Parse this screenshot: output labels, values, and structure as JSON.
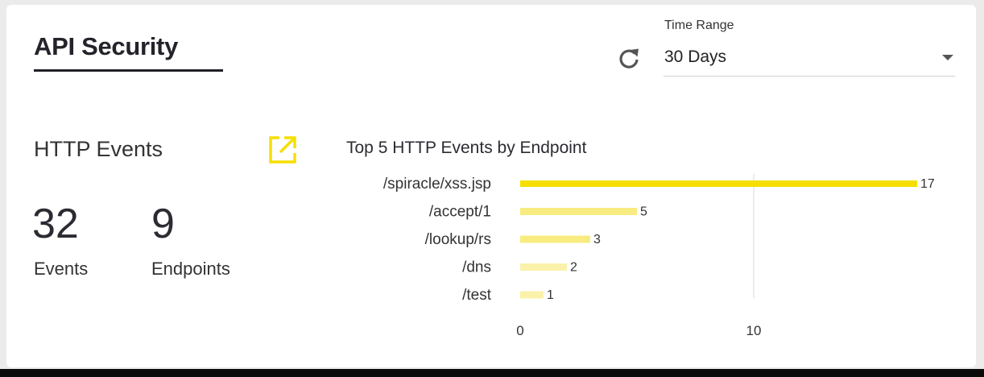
{
  "header": {
    "title": "API Security",
    "time_range_label": "Time Range",
    "time_range_value": "30 Days"
  },
  "http_events": {
    "title": "HTTP Events",
    "stats": [
      {
        "value": "32",
        "label": "Events"
      },
      {
        "value": "9",
        "label": "Endpoints"
      }
    ]
  },
  "colors": {
    "accent": "#f5df00",
    "bar_light": "#f8ec80",
    "bar_lighter": "#faf2aa",
    "text": "#2b2b33"
  },
  "icons": [
    "refresh-icon",
    "chevron-down-icon",
    "external-link-icon"
  ],
  "chart_data": {
    "type": "bar",
    "orientation": "horizontal",
    "title": "Top 5 HTTP Events by Endpoint",
    "categories": [
      "/spiracle/xss.jsp",
      "/accept/1",
      "/lookup/rs",
      "/dns",
      "/test"
    ],
    "values": [
      17,
      5,
      3,
      2,
      1
    ],
    "xticks": [
      0,
      10
    ],
    "xlim": [
      0,
      17
    ],
    "grid": "vertical at tick 10"
  }
}
